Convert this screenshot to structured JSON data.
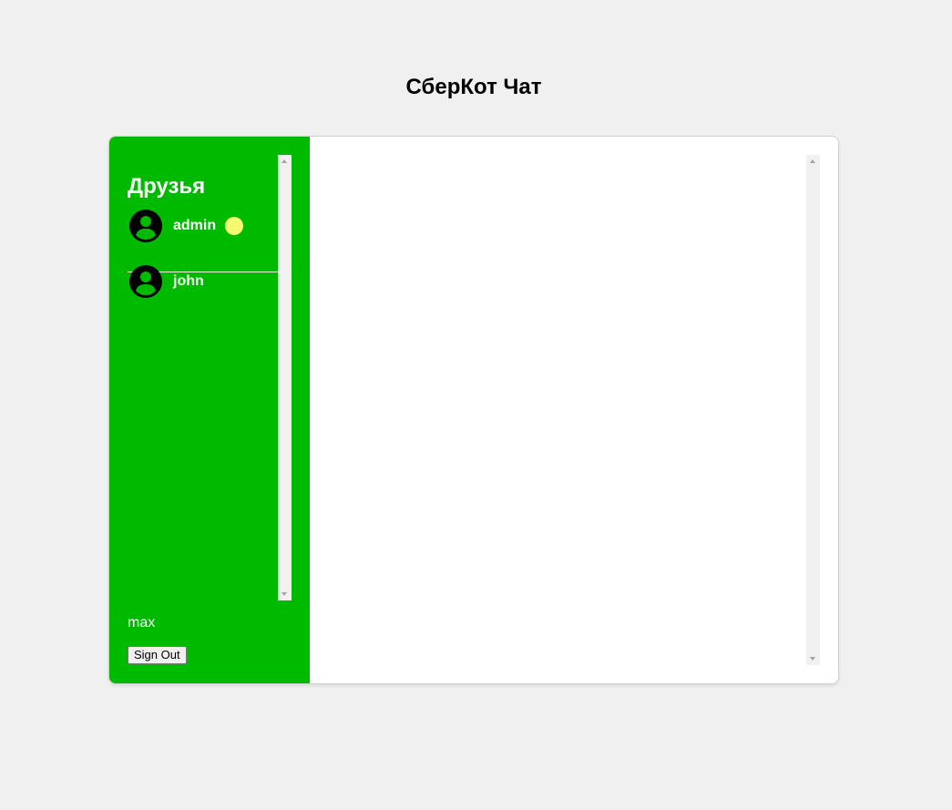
{
  "header": {
    "title": "СберКот Чат"
  },
  "sidebar": {
    "heading": "Друзья",
    "friends": [
      {
        "name": "admin",
        "online": true,
        "avatar_icon": "user-avatar-icon"
      },
      {
        "name": "john",
        "online": false,
        "avatar_icon": "user-avatar-icon"
      }
    ],
    "current_user": "max",
    "sign_out_label": "Sign Out"
  },
  "colors": {
    "sidebar_bg": "#00ba00",
    "online_indicator": "#f6f86f",
    "page_bg": "#f0f0f0",
    "chat_bg": "#ffffff"
  }
}
